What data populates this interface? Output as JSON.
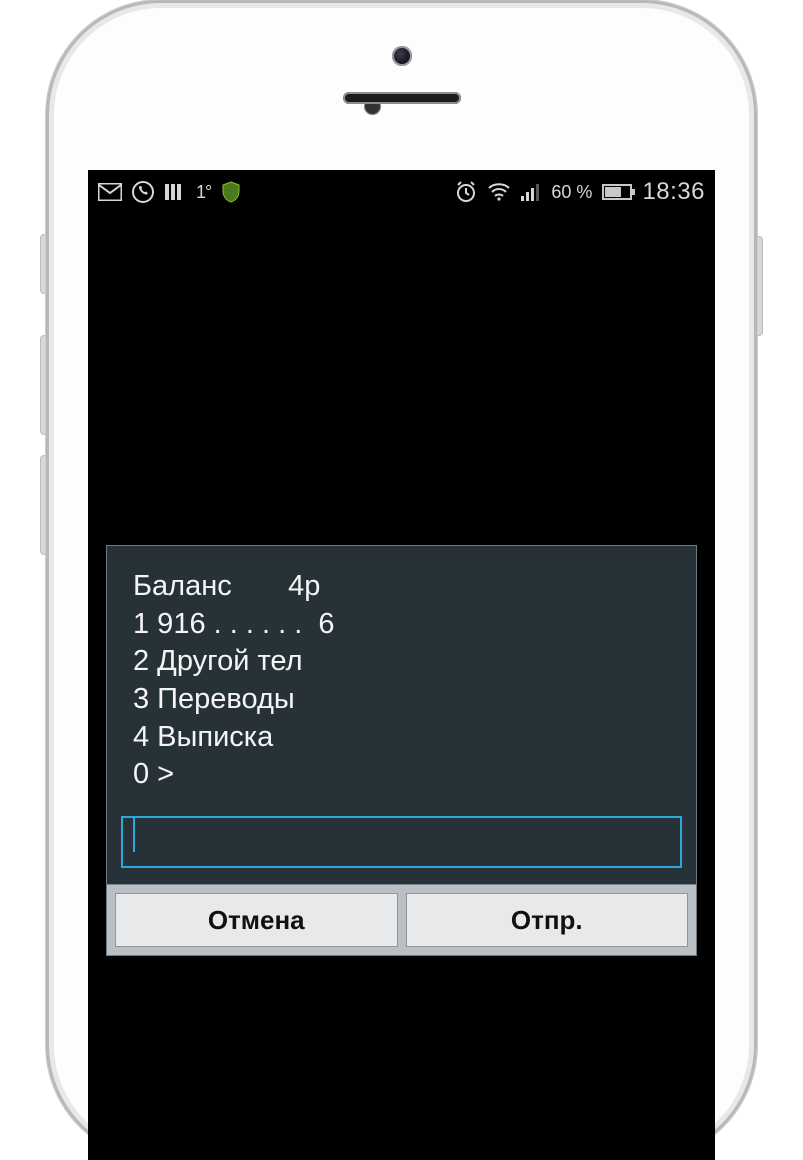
{
  "statusbar": {
    "temperature": "1°",
    "battery_percent_text": "60 %",
    "battery_level": 60,
    "clock": "18:36"
  },
  "dialog": {
    "lines": [
      "Баланс       4р",
      "1 916 . . . . . .  6",
      "2 Другой тел",
      "3 Переводы",
      "4 Выписка",
      "0 >"
    ],
    "input_value": "",
    "cancel_label": "Отмена",
    "send_label": "Отпр."
  }
}
